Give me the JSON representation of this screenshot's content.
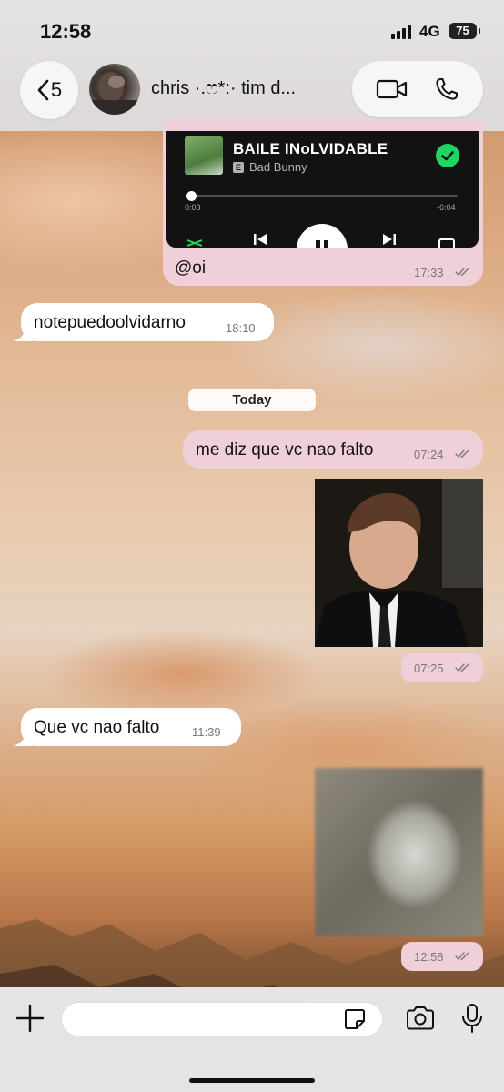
{
  "status_bar": {
    "time": "12:58",
    "network": "4G",
    "battery": "75"
  },
  "header": {
    "back_count": "5",
    "contact_name": "chris ·.ෆ*:· tim d...",
    "video_icon": "video-camera-icon",
    "phone_icon": "phone-icon"
  },
  "music_card": {
    "title": "BAILE INoLVIDABLE",
    "explicit": "E",
    "artist": "Bad Bunny",
    "elapsed": "0:03",
    "remaining": "-6:04",
    "progress": 0.01
  },
  "messages": [
    {
      "direction": "out",
      "type": "text",
      "text": "@oi",
      "time": "17:33"
    },
    {
      "direction": "in",
      "type": "text",
      "text": "notepuedoolvidarno",
      "time": "18:10"
    },
    {
      "direction": "out",
      "type": "text",
      "text": "me diz que vc nao falto",
      "time": "07:24"
    },
    {
      "direction": "out",
      "type": "photo",
      "time": "07:25"
    },
    {
      "direction": "in",
      "type": "text",
      "text": "Que vc nao falto",
      "time": "11:39"
    },
    {
      "direction": "out",
      "type": "photo",
      "time": "12:58"
    }
  ],
  "day_separator": "Today",
  "composer": {
    "placeholder": "",
    "icons": [
      "plus-icon",
      "sticker-icon",
      "camera-icon",
      "microphone-icon"
    ]
  },
  "colors": {
    "outgoing_bubble": "#f0d0d8",
    "incoming_bubble": "#ffffff",
    "spotify_green": "#1ed760"
  }
}
